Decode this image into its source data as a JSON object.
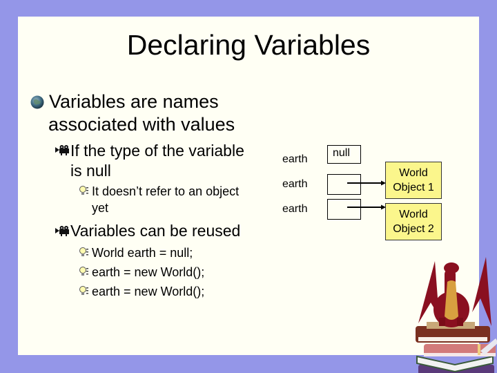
{
  "slide": {
    "title": "Declaring Variables",
    "bullets": {
      "main": {
        "icon": "globe-bullet-icon",
        "line1": "Variables are names",
        "line2": "associated with values"
      },
      "sub1": {
        "icon": "film-camera-bullet-icon",
        "line1": "If the type of the variable",
        "line2": "is null",
        "children": [
          {
            "icon": "lightbulb-bullet-icon",
            "line1": "It doesn’t refer to an object",
            "line2": "yet"
          }
        ]
      },
      "sub2": {
        "icon": "film-camera-bullet-icon",
        "line1": "Variables can be reused",
        "children": [
          {
            "icon": "lightbulb-bullet-icon",
            "text": "World earth = null;"
          },
          {
            "icon": "lightbulb-bullet-icon",
            "text": "earth = new World();"
          },
          {
            "icon": "lightbulb-bullet-icon",
            "text": "earth = new World();"
          }
        ]
      }
    },
    "diagram": {
      "variables": [
        {
          "label": "earth",
          "value": "null"
        },
        {
          "label": "earth",
          "value": ""
        },
        {
          "label": "earth",
          "value": ""
        }
      ],
      "objects": [
        {
          "line1": "World",
          "line2": "Object 1"
        },
        {
          "line1": "World",
          "line2": "Object 2"
        }
      ]
    },
    "decoration": "dragon-on-books-image",
    "colors": {
      "background": "#9496e8",
      "slide": "#fffff4",
      "object_fill": "#fbf68c"
    }
  }
}
